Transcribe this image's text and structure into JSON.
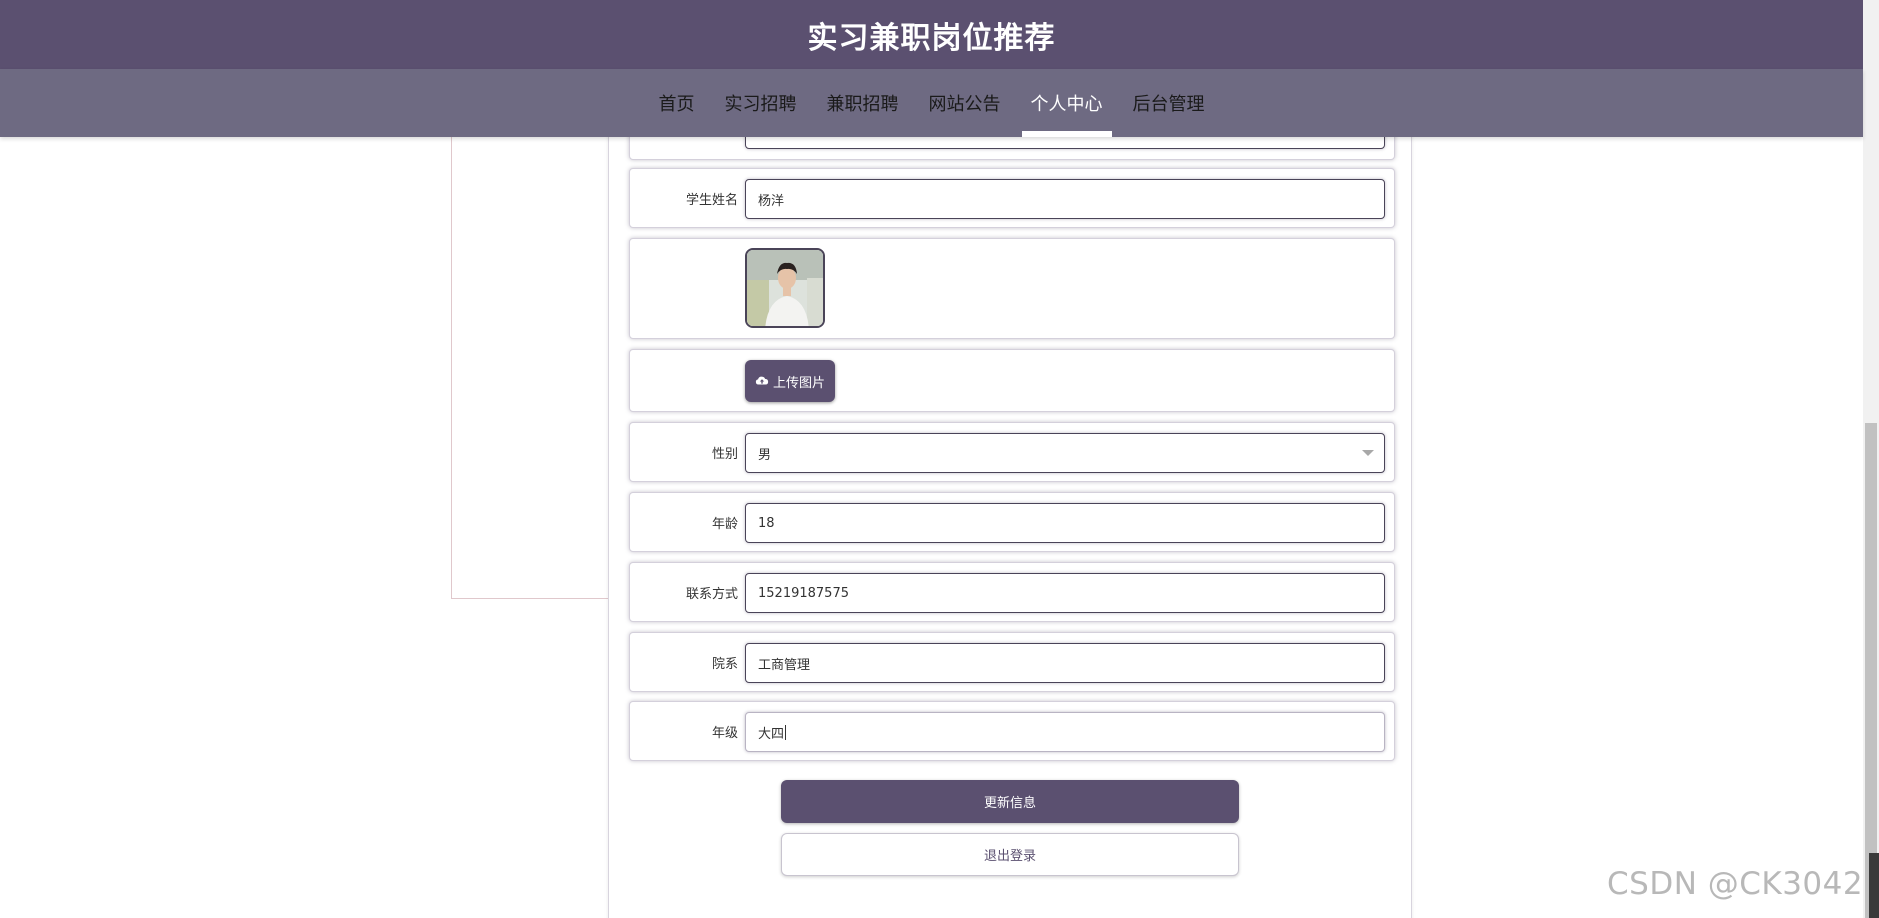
{
  "header": {
    "title": "实习兼职岗位推荐"
  },
  "nav": {
    "items": [
      {
        "label": "首页"
      },
      {
        "label": "实习招聘"
      },
      {
        "label": "兼职招聘"
      },
      {
        "label": "网站公告"
      },
      {
        "label": "个人中心",
        "active": true
      },
      {
        "label": "后台管理"
      }
    ]
  },
  "form": {
    "student_name": {
      "label": "学生姓名",
      "value": "杨洋"
    },
    "avatar": {
      "icon": "student-photo"
    },
    "upload": {
      "label": "上传图片",
      "icon": "cloud-upload-icon"
    },
    "gender": {
      "label": "性别",
      "value": "男"
    },
    "age": {
      "label": "年龄",
      "value": "18"
    },
    "contact": {
      "label": "联系方式",
      "value": "15219187575"
    },
    "department": {
      "label": "院系",
      "value": "工商管理"
    },
    "grade": {
      "label": "年级",
      "value": "大四"
    }
  },
  "actions": {
    "update_label": "更新信息",
    "logout_label": "退出登录"
  },
  "watermark": "CSDN @CK3042",
  "colors": {
    "primary": "#5b5070",
    "nav_bg": "#6e6a82"
  }
}
